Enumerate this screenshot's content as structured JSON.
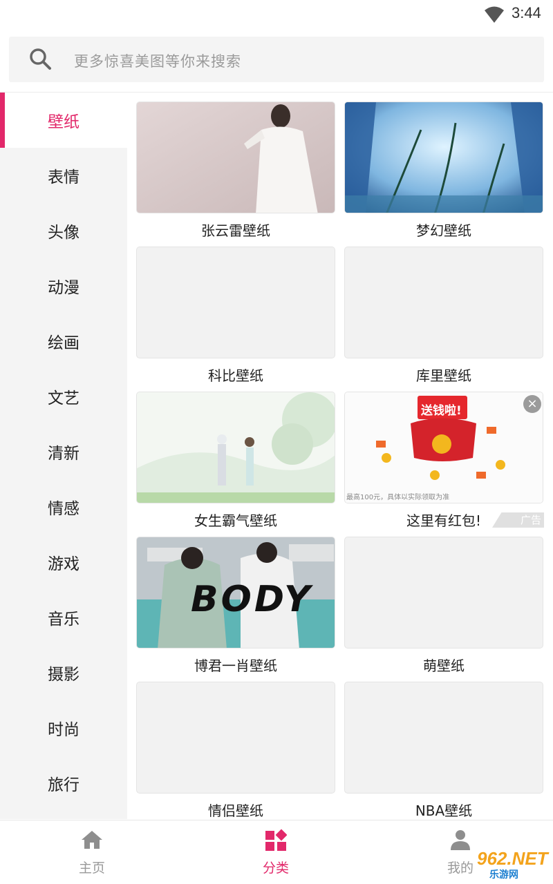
{
  "status_bar": {
    "time": "3:44",
    "wifi_icon": "wifi-icon"
  },
  "search": {
    "placeholder": "更多惊喜美图等你来搜索",
    "icon": "search-icon"
  },
  "sidebar": {
    "items": [
      {
        "label": "壁纸",
        "active": true
      },
      {
        "label": "表情"
      },
      {
        "label": "头像"
      },
      {
        "label": "动漫"
      },
      {
        "label": "绘画"
      },
      {
        "label": "文艺"
      },
      {
        "label": "清新"
      },
      {
        "label": "情感"
      },
      {
        "label": "游戏"
      },
      {
        "label": "音乐"
      },
      {
        "label": "摄影"
      },
      {
        "label": "时尚"
      },
      {
        "label": "旅行"
      }
    ],
    "accent_color": "#e2286a"
  },
  "grid": {
    "items": [
      {
        "label": "张云雷壁纸"
      },
      {
        "label": "梦幻壁纸"
      },
      {
        "label": "科比壁纸"
      },
      {
        "label": "库里壁纸"
      },
      {
        "label": "女生霸气壁纸"
      },
      {
        "label": "这里有红包!"
      },
      {
        "label": "博君一肖壁纸"
      },
      {
        "label": "萌壁纸"
      },
      {
        "label": "情侣壁纸"
      },
      {
        "label": "NBA壁纸"
      }
    ],
    "ad": {
      "banner_text": "送钱啦!",
      "fine_print": "最高100元，具体以实际领取为准",
      "badge": "广告",
      "close_icon": "close-icon"
    },
    "body_text": "BODY"
  },
  "bottom_nav": {
    "items": [
      {
        "label": "主页",
        "icon": "home-icon"
      },
      {
        "label": "分类",
        "icon": "category-icon",
        "active": true
      },
      {
        "label": "我的",
        "icon": "user-icon"
      }
    ]
  },
  "watermark": {
    "text": "962.NET",
    "sub": "乐游网"
  }
}
